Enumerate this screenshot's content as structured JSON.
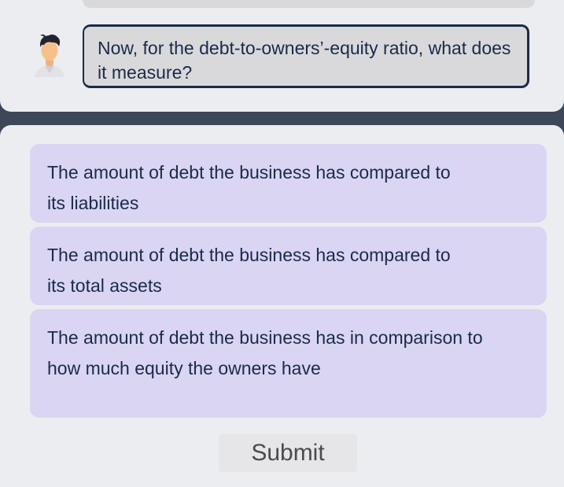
{
  "chat": {
    "question": "Now, for the debt-to-owners’-equity ratio, what does it measure?",
    "avatar_icon": "male-student-avatar-icon"
  },
  "options": [
    "The amount of debt the business has compared to its liabilities",
    "The amount of debt the business has compared to its total assets",
    "The amount of debt the business has in comparison to how much equity the owners have"
  ],
  "submit_label": "Submit",
  "colors": {
    "background": "#3e4659",
    "panel": "#ecedf0",
    "bubble": "#d9d9db",
    "bubble_border": "#1b2a4a",
    "option": "#d9d5f3",
    "text": "#1b2a4a"
  }
}
